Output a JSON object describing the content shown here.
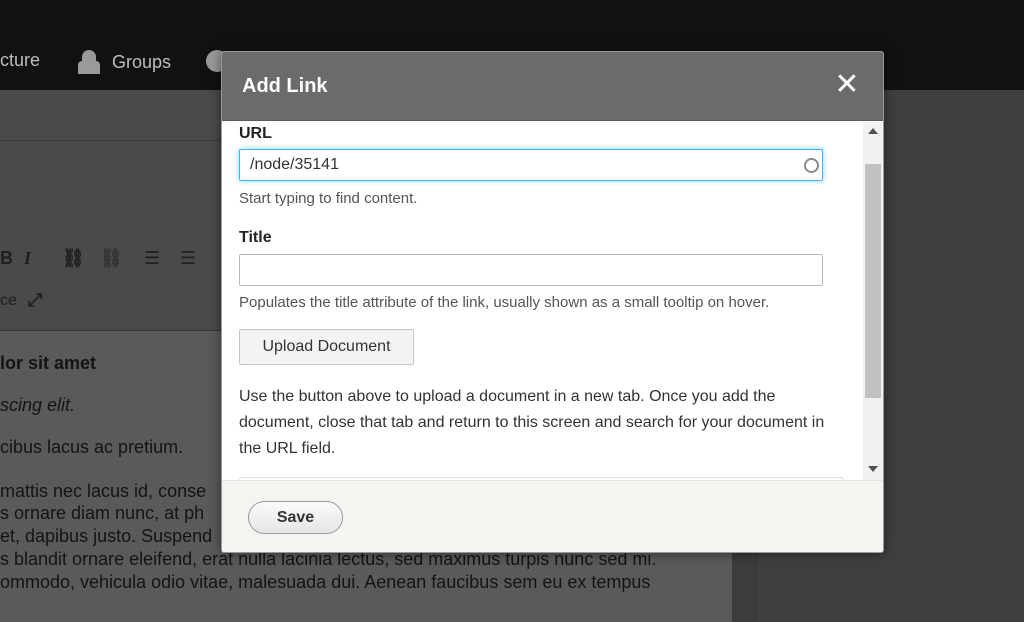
{
  "toolbar": {
    "structure_label": "cture",
    "groups_label": "Groups"
  },
  "editor": {
    "tool_source_partial": "ce",
    "lines": [
      "lor sit amet",
      "scing elit.",
      "cibus lacus ac pretium.",
      " mattis nec lacus id, conse",
      "s ornare diam nunc, at ph",
      "et, dapibus justo. Suspend",
      "s blandit ornare eleifend, erat nulla lacinia lectus, sed maximus turpis nunc sed mi.",
      "ommodo, vehicula odio vitae, malesuada dui. Aenean faucibus sem eu ex tempus"
    ]
  },
  "dialog": {
    "title": "Add Link",
    "close_symbol": "✕",
    "url": {
      "label": "URL",
      "value": "/node/35141",
      "description": "Start typing to find content."
    },
    "title_field": {
      "label": "Title",
      "value": "",
      "description": "Populates the title attribute of the link, usually shown as a small tooltip on hover."
    },
    "upload_button": "Upload Document",
    "help_text": "Use the button above to upload a document in a new tab. Once you add the document, close that tab and return to this screen and search for your document in the URL field.",
    "save_button": "Save"
  },
  "colors": {
    "header_bg": "#6b6b6b",
    "focus_border": "#40b6ff",
    "footer_bg": "#f5f4f1"
  }
}
